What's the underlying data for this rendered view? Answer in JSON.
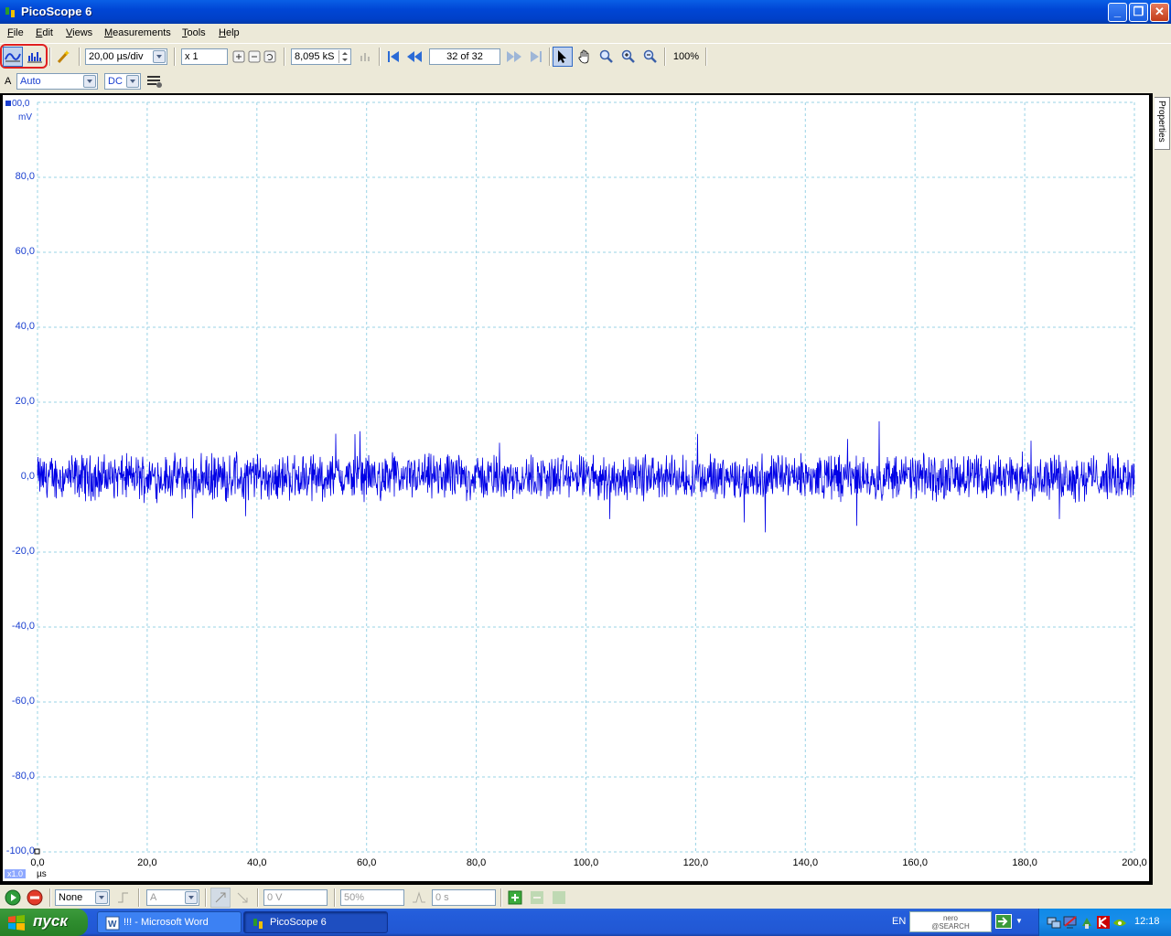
{
  "window": {
    "title": "PicoScope 6"
  },
  "menu": [
    {
      "label": "File",
      "key": "F",
      "rest": "ile"
    },
    {
      "label": "Edit",
      "key": "E",
      "rest": "dit"
    },
    {
      "label": "Views",
      "key": "V",
      "rest": "iews"
    },
    {
      "label": "Measurements",
      "key": "M",
      "rest": "easurements"
    },
    {
      "label": "Tools",
      "key": "T",
      "rest": "ools"
    },
    {
      "label": "Help",
      "key": "H",
      "rest": "elp"
    }
  ],
  "toolbar": {
    "timebase": "20,00 µs/div",
    "zoom": "x 1",
    "samples": "8,095 kS",
    "buffer": "32 of 32",
    "zoom_percent": "100%"
  },
  "channel": {
    "name": "A",
    "range": "Auto",
    "coupling": "DC"
  },
  "scope": {
    "trace_color": "#0000e6",
    "grid_color": "#9ad3e6",
    "y_unit": "mV",
    "x_unit": "µs",
    "x_scale": "x1.0",
    "y_top_label": "00,0",
    "y_ticks": [
      "80,0",
      "60,0",
      "40,0",
      "20,0",
      "0,0",
      "-20,0",
      "-40,0",
      "-60,0",
      "-80,0",
      "-100,0"
    ],
    "x_ticks": [
      "0,0",
      "20,0",
      "40,0",
      "60,0",
      "80,0",
      "100,0",
      "120,0",
      "140,0",
      "160,0",
      "180,0",
      "200,0"
    ],
    "side_tab": "Properties"
  },
  "trigger": {
    "mode": "None",
    "source": "A",
    "threshold": "0 V",
    "pre_trigger": "50%",
    "delay": "0 s"
  },
  "taskbar": {
    "start": "пуск",
    "tasks": [
      "!!! - Microsoft Word",
      "PicoScope 6"
    ],
    "lang": "EN",
    "search": "nero\n@SEARCH",
    "clock": "12:18"
  }
}
